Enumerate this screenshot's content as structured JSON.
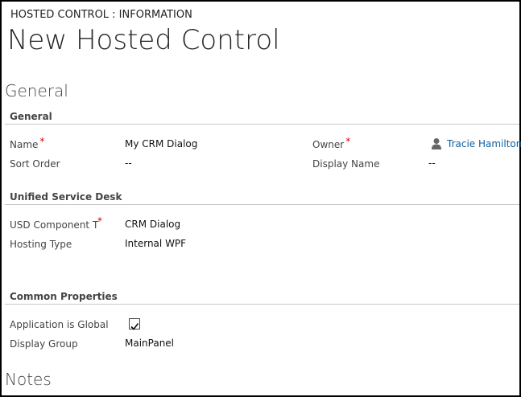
{
  "header": {
    "entity_label": "HOSTED CONTROL : INFORMATION",
    "record_title": "New Hosted Control"
  },
  "tabs": {
    "general_title": "General",
    "notes_title": "Notes"
  },
  "sections": {
    "general": {
      "title": "General",
      "name_label": "Name",
      "name_value": "My CRM Dialog",
      "sort_order_label": "Sort Order",
      "sort_order_value": "--",
      "owner_label": "Owner",
      "owner_value": "Tracie Hamilton",
      "display_name_label": "Display Name",
      "display_name_value": "--",
      "required_marker": "*"
    },
    "usd": {
      "title": "Unified Service Desk",
      "component_type_label": "USD Component T",
      "component_type_value": "CRM Dialog",
      "hosting_type_label": "Hosting Type",
      "hosting_type_value": "Internal WPF",
      "required_marker": "*"
    },
    "common": {
      "title": "Common Properties",
      "app_global_label": "Application is Global",
      "app_global_checked": true,
      "display_group_label": "Display Group",
      "display_group_value": "MainPanel"
    }
  },
  "icons": {
    "owner": "user-icon",
    "checkbox": "checkmark-icon"
  }
}
